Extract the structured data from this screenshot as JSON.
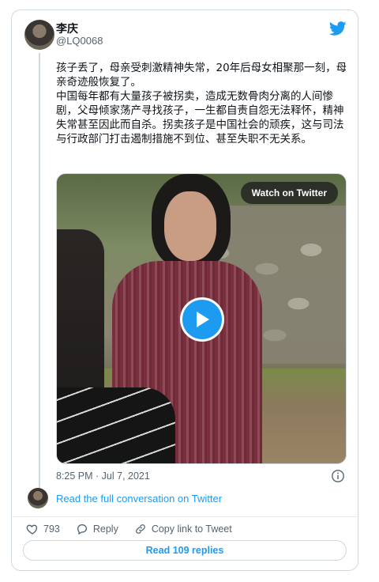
{
  "author": {
    "name": "李庆",
    "handle": "@LQ0068"
  },
  "tweet": {
    "paragraph1": "孩子丢了，母亲受刺激精神失常，20年后母女相聚那一刻，母亲奇迹般恢复了。",
    "paragraph2": "中国每年都有大量孩子被拐卖，造成无数骨肉分离的人间惨剧，父母倾家荡产寻找孩子，一生都自责自怨无法释怀，精神失常甚至因此而自杀。拐卖孩子是中国社会的顽疾，这与司法与行政部门打击遏制措施不到位、甚至失职不无关系。"
  },
  "media": {
    "watch_label": "Watch on Twitter"
  },
  "meta": {
    "timestamp": "8:25 PM · Jul 7, 2021"
  },
  "conversation": {
    "link_label": "Read the full conversation on Twitter"
  },
  "actions": {
    "likes": "793",
    "reply_label": "Reply",
    "copy_label": "Copy link to Tweet"
  },
  "replies": {
    "label": "Read 109 replies"
  },
  "colors": {
    "accent": "#1d9bf0",
    "muted": "#536471",
    "border": "#cfd9de"
  },
  "icons": [
    "twitter-bird-icon",
    "play-icon",
    "info-icon",
    "heart-icon",
    "reply-icon",
    "link-icon"
  ]
}
